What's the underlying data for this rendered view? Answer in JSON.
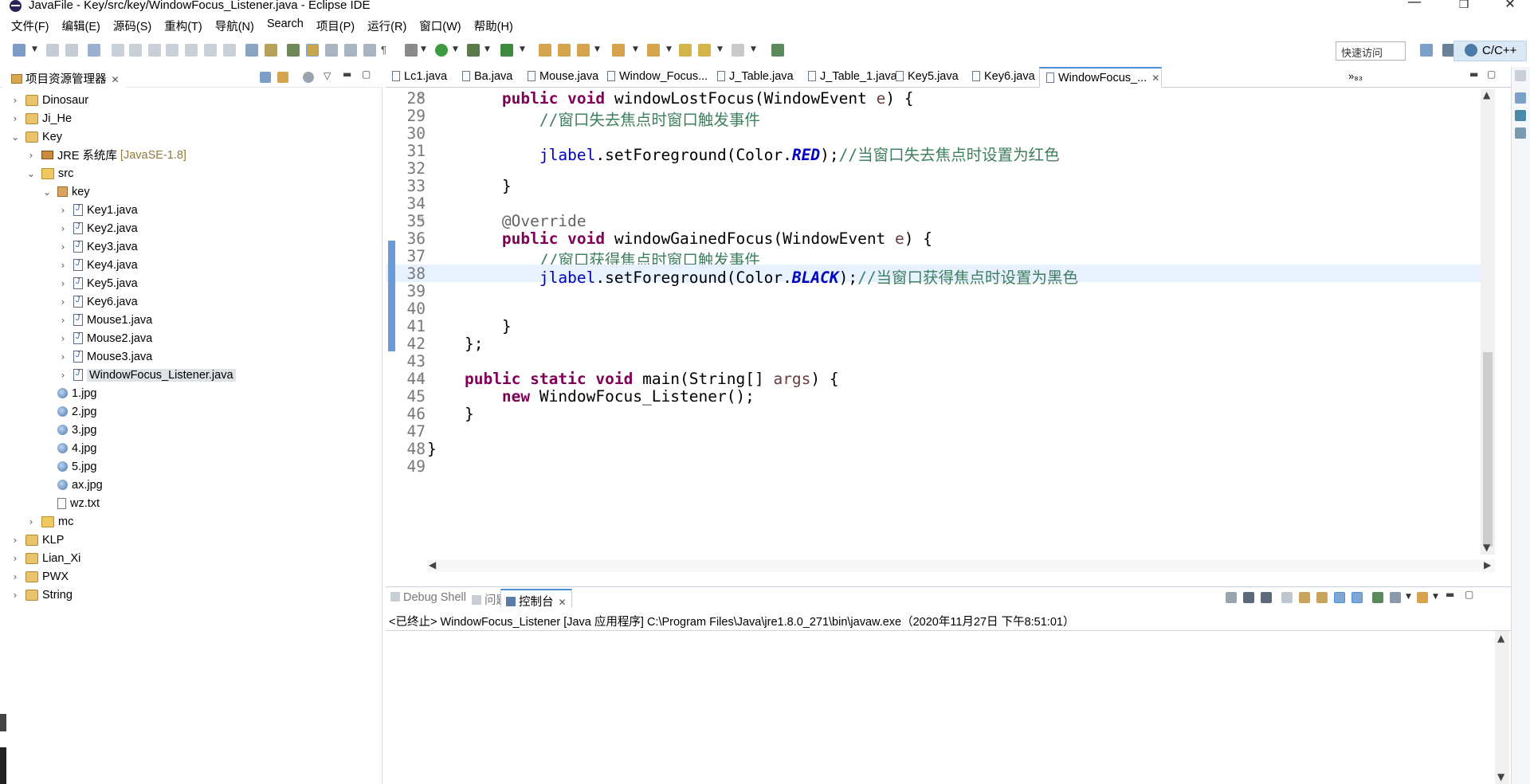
{
  "window": {
    "title": "JavaFile - Key/src/key/WindowFocus_Listener.java - Eclipse IDE",
    "minimize": "—",
    "maximize": "❐",
    "close": "✕"
  },
  "menu": [
    "文件(F)",
    "编辑(E)",
    "源码(S)",
    "重构(T)",
    "导航(N)",
    "Search",
    "项目(P)",
    "运行(R)",
    "窗口(W)",
    "帮助(H)"
  ],
  "toolbar": {
    "quick_access_placeholder": "快速访问",
    "perspective_label": "C/C++"
  },
  "explorer": {
    "tab_label": "项目资源管理器",
    "items": [
      {
        "label": "Dinosaur",
        "type": "project",
        "level": 0,
        "expanded": false
      },
      {
        "label": "Ji_He",
        "type": "project",
        "level": 0,
        "expanded": false
      },
      {
        "label": "Key",
        "type": "project",
        "level": 0,
        "expanded": true
      },
      {
        "label": "JRE 系统库",
        "tag": "[JavaSE-1.8]",
        "type": "jre",
        "level": 1,
        "expanded": false
      },
      {
        "label": "src",
        "type": "srcfolder",
        "level": 1,
        "expanded": true
      },
      {
        "label": "key",
        "type": "pkg",
        "level": 2,
        "expanded": true
      },
      {
        "label": "Key1.java",
        "type": "java",
        "level": 3,
        "expanded": false
      },
      {
        "label": "Key2.java",
        "type": "java",
        "level": 3,
        "expanded": false
      },
      {
        "label": "Key3.java",
        "type": "java",
        "level": 3,
        "expanded": false
      },
      {
        "label": "Key4.java",
        "type": "java",
        "level": 3,
        "expanded": false
      },
      {
        "label": "Key5.java",
        "type": "java",
        "level": 3,
        "expanded": false
      },
      {
        "label": "Key6.java",
        "type": "java",
        "level": 3,
        "expanded": false
      },
      {
        "label": "Mouse1.java",
        "type": "java",
        "level": 3,
        "expanded": false
      },
      {
        "label": "Mouse2.java",
        "type": "java",
        "level": 3,
        "expanded": false
      },
      {
        "label": "Mouse3.java",
        "type": "java",
        "level": 3,
        "expanded": false
      },
      {
        "label": "WindowFocus_Listener.java",
        "type": "java",
        "level": 3,
        "expanded": false,
        "selected": true
      },
      {
        "label": "1.jpg",
        "type": "image",
        "level": 2
      },
      {
        "label": "2.jpg",
        "type": "image",
        "level": 2
      },
      {
        "label": "3.jpg",
        "type": "image",
        "level": 2
      },
      {
        "label": "4.jpg",
        "type": "image",
        "level": 2
      },
      {
        "label": "5.jpg",
        "type": "image",
        "level": 2
      },
      {
        "label": "ax.jpg",
        "type": "image",
        "level": 2
      },
      {
        "label": "wz.txt",
        "type": "txt",
        "level": 2
      },
      {
        "label": "mc",
        "type": "folder",
        "level": 1,
        "expanded": false
      },
      {
        "label": "KLP",
        "type": "project",
        "level": 0,
        "expanded": false
      },
      {
        "label": "Lian_Xi",
        "type": "project",
        "level": 0,
        "expanded": false
      },
      {
        "label": "PWX",
        "type": "project",
        "level": 0,
        "expanded": false
      },
      {
        "label": "String",
        "type": "project",
        "level": 0,
        "expanded": false
      }
    ]
  },
  "editor": {
    "tabs": [
      "Lc1.java",
      "Ba.java",
      "Mouse.java",
      "Window_Focus...",
      "J_Table.java",
      "J_Table_1.java",
      "Key5.java",
      "Key6.java",
      "WindowFocus_..."
    ],
    "active_tab": 8,
    "overflow": "»₈₃",
    "lines": [
      {
        "n": "28",
        "segs": [
          [
            "        ",
            ""
          ],
          [
            "public",
            "kw"
          ],
          [
            " ",
            ""
          ],
          [
            "void",
            "kw"
          ],
          [
            " windowLostFocus(WindowEvent ",
            ""
          ],
          [
            "e",
            "param"
          ],
          [
            ") {",
            ""
          ]
        ],
        "fold": true
      },
      {
        "n": "29",
        "segs": [
          [
            "            ",
            ""
          ],
          [
            "//窗口失去焦点时窗口触发事件",
            "cm"
          ]
        ]
      },
      {
        "n": "30",
        "segs": []
      },
      {
        "n": "31",
        "segs": [
          [
            "            ",
            ""
          ],
          [
            "jlabel",
            "fld"
          ],
          [
            ".setForeground(Color.",
            ""
          ],
          [
            "RED",
            "cst"
          ],
          [
            ");",
            ""
          ],
          [
            "//当窗口失去焦点时设置为红色",
            "cm"
          ]
        ]
      },
      {
        "n": "32",
        "segs": []
      },
      {
        "n": "33",
        "segs": [
          [
            "        }",
            ""
          ]
        ]
      },
      {
        "n": "34",
        "segs": []
      },
      {
        "n": "35",
        "segs": [
          [
            "        ",
            ""
          ],
          [
            "@Override",
            "ann"
          ]
        ],
        "fold": true
      },
      {
        "n": "36",
        "segs": [
          [
            "        ",
            ""
          ],
          [
            "public",
            "kw"
          ],
          [
            " ",
            ""
          ],
          [
            "void",
            "kw"
          ],
          [
            " windowGainedFocus(WindowEvent ",
            ""
          ],
          [
            "e",
            "param"
          ],
          [
            ") {",
            ""
          ]
        ]
      },
      {
        "n": "37",
        "segs": [
          [
            "            ",
            ""
          ],
          [
            "//窗口获得焦点时窗口触发事件",
            "cm"
          ]
        ]
      },
      {
        "n": "38",
        "segs": [
          [
            "            ",
            ""
          ],
          [
            "jlabel",
            "fld"
          ],
          [
            ".setForeground(Color.",
            ""
          ],
          [
            "BLACK",
            "cst"
          ],
          [
            ");",
            ""
          ],
          [
            "//当窗口获得焦点时设置为黑色",
            "cm"
          ]
        ],
        "current": true
      },
      {
        "n": "39",
        "segs": []
      },
      {
        "n": "40",
        "segs": []
      },
      {
        "n": "41",
        "segs": [
          [
            "        }",
            ""
          ]
        ]
      },
      {
        "n": "42",
        "segs": [
          [
            "    };",
            ""
          ]
        ]
      },
      {
        "n": "43",
        "segs": []
      },
      {
        "n": "44",
        "segs": [
          [
            "    ",
            ""
          ],
          [
            "public",
            "kw"
          ],
          [
            " ",
            ""
          ],
          [
            "static",
            "kw"
          ],
          [
            " ",
            ""
          ],
          [
            "void",
            "kw"
          ],
          [
            " main(String[] ",
            ""
          ],
          [
            "args",
            "param"
          ],
          [
            ") {",
            ""
          ]
        ],
        "fold": true
      },
      {
        "n": "45",
        "segs": [
          [
            "        ",
            ""
          ],
          [
            "new",
            "kw"
          ],
          [
            " WindowFocus_Listener();",
            ""
          ]
        ]
      },
      {
        "n": "46",
        "segs": [
          [
            "    }",
            ""
          ]
        ]
      },
      {
        "n": "47",
        "segs": []
      },
      {
        "n": "48",
        "segs": [
          [
            "}",
            ""
          ]
        ]
      },
      {
        "n": "49",
        "segs": []
      }
    ]
  },
  "console": {
    "tabs": [
      "Debug Shell",
      "问题",
      "控制台"
    ],
    "active_tab": 2,
    "status": "<已终止> WindowFocus_Listener [Java 应用程序] C:\\Program Files\\Java\\jre1.8.0_271\\bin\\javaw.exe（2020年11月27日 下午8:51:01）"
  },
  "colors": {
    "keyword": "#7f0055",
    "comment": "#3f7f5f",
    "field": "#0000c0",
    "annotation": "#646464",
    "current_line": "#e8f2fe",
    "accent": "#4a8ed8"
  }
}
